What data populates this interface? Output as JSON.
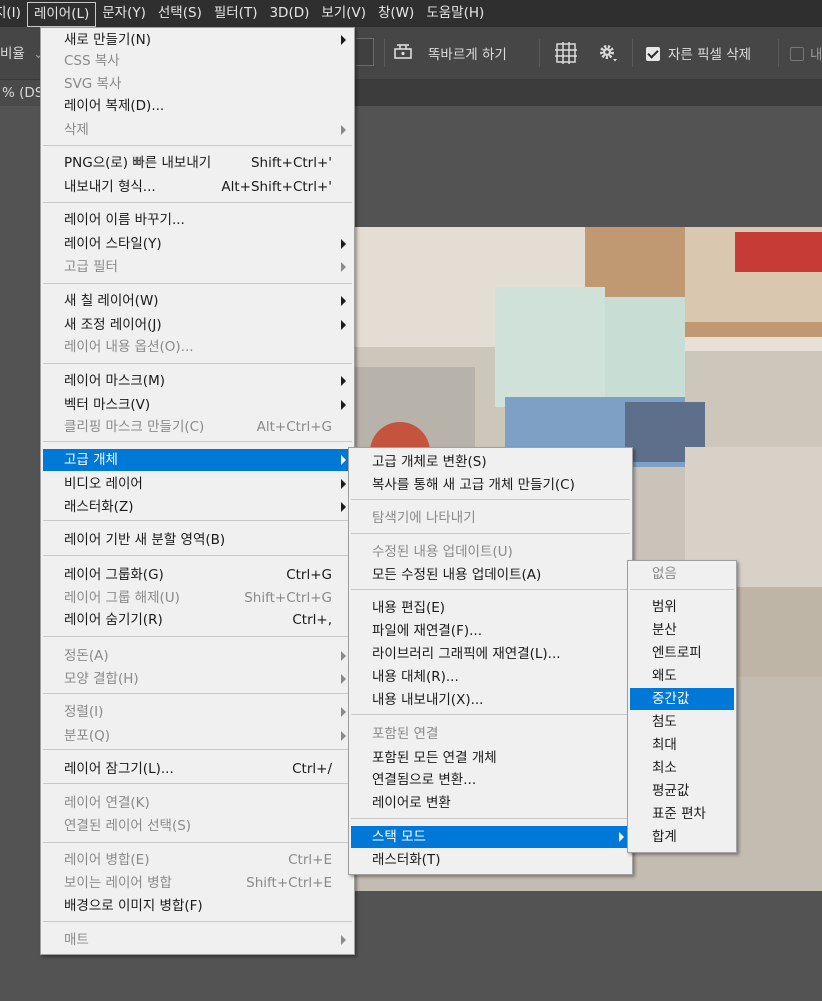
{
  "menubar": {
    "items": [
      "지(I)",
      "레이어(L)",
      "문자(Y)",
      "선택(S)",
      "필터(T)",
      "3D(D)",
      "보기(V)",
      "창(W)",
      "도움말(H)"
    ]
  },
  "optionsbar": {
    "left_label": "비율",
    "straighten_label": "똑바르게 하기",
    "delete_cropped_label": "자른 픽셀 삭제",
    "right_cut_label": "내"
  },
  "tabbar": {
    "tab_label": "% (DS"
  },
  "layer_menu": {
    "items": [
      {
        "label": "새로 만들기(N)",
        "shortcut": "",
        "submenu": true,
        "disabled": false
      },
      {
        "label": "CSS 복사",
        "shortcut": "",
        "submenu": false,
        "disabled": true
      },
      {
        "label": "SVG 복사",
        "shortcut": "",
        "submenu": false,
        "disabled": true
      },
      {
        "label": "레이어 복제(D)...",
        "shortcut": "",
        "submenu": false,
        "disabled": false
      },
      {
        "label": "삭제",
        "shortcut": "",
        "submenu": true,
        "disabled": true
      },
      {
        "label": "PNG으(로) 빠른 내보내기",
        "shortcut": "Shift+Ctrl+'",
        "submenu": false,
        "disabled": false
      },
      {
        "label": "내보내기 형식...",
        "shortcut": "Alt+Shift+Ctrl+'",
        "submenu": false,
        "disabled": false
      },
      {
        "label": "레이어 이름 바꾸기...",
        "shortcut": "",
        "submenu": false,
        "disabled": false
      },
      {
        "label": "레이어 스타일(Y)",
        "shortcut": "",
        "submenu": true,
        "disabled": false
      },
      {
        "label": "고급 필터",
        "shortcut": "",
        "submenu": true,
        "disabled": true
      },
      {
        "label": "새 칠 레이어(W)",
        "shortcut": "",
        "submenu": true,
        "disabled": false
      },
      {
        "label": "새 조정 레이어(J)",
        "shortcut": "",
        "submenu": true,
        "disabled": false
      },
      {
        "label": "레이어 내용 옵션(O)...",
        "shortcut": "",
        "submenu": false,
        "disabled": true
      },
      {
        "label": "레이어 마스크(M)",
        "shortcut": "",
        "submenu": true,
        "disabled": false
      },
      {
        "label": "벡터 마스크(V)",
        "shortcut": "",
        "submenu": true,
        "disabled": false
      },
      {
        "label": "클리핑 마스크 만들기(C)",
        "shortcut": "Alt+Ctrl+G",
        "submenu": false,
        "disabled": true
      },
      {
        "label": "고급 개체",
        "shortcut": "",
        "submenu": true,
        "disabled": false,
        "highlighted": true
      },
      {
        "label": "비디오 레이어",
        "shortcut": "",
        "submenu": true,
        "disabled": false
      },
      {
        "label": "래스터화(Z)",
        "shortcut": "",
        "submenu": true,
        "disabled": false
      },
      {
        "label": "레이어 기반 새 분할 영역(B)",
        "shortcut": "",
        "submenu": false,
        "disabled": false
      },
      {
        "label": "레이어 그룹화(G)",
        "shortcut": "Ctrl+G",
        "submenu": false,
        "disabled": false
      },
      {
        "label": "레이어 그룹 해제(U)",
        "shortcut": "Shift+Ctrl+G",
        "submenu": false,
        "disabled": true
      },
      {
        "label": "레이어 숨기기(R)",
        "shortcut": "Ctrl+,",
        "submenu": false,
        "disabled": false
      },
      {
        "label": "정돈(A)",
        "shortcut": "",
        "submenu": true,
        "disabled": true
      },
      {
        "label": "모양 결합(H)",
        "shortcut": "",
        "submenu": true,
        "disabled": true
      },
      {
        "label": "정렬(I)",
        "shortcut": "",
        "submenu": true,
        "disabled": true
      },
      {
        "label": "분포(Q)",
        "shortcut": "",
        "submenu": true,
        "disabled": true
      },
      {
        "label": "레이어 잠그기(L)...",
        "shortcut": "Ctrl+/",
        "submenu": false,
        "disabled": false
      },
      {
        "label": "레이어 연결(K)",
        "shortcut": "",
        "submenu": false,
        "disabled": true
      },
      {
        "label": "연결된 레이어 선택(S)",
        "shortcut": "",
        "submenu": false,
        "disabled": true
      },
      {
        "label": "레이어 병합(E)",
        "shortcut": "Ctrl+E",
        "submenu": false,
        "disabled": true
      },
      {
        "label": "보이는 레이어 병합",
        "shortcut": "Shift+Ctrl+E",
        "submenu": false,
        "disabled": true
      },
      {
        "label": "배경으로 이미지 병합(F)",
        "shortcut": "",
        "submenu": false,
        "disabled": false
      },
      {
        "label": "매트",
        "shortcut": "",
        "submenu": true,
        "disabled": true
      }
    ]
  },
  "smart_object_menu": {
    "items": [
      {
        "label": "고급 개체로 변환(S)",
        "submenu": false,
        "disabled": false
      },
      {
        "label": "복사를 통해 새 고급 개체 만들기(C)",
        "submenu": false,
        "disabled": false
      },
      {
        "label": "탐색기에 나타내기",
        "submenu": false,
        "disabled": true
      },
      {
        "label": "수정된 내용 업데이트(U)",
        "submenu": false,
        "disabled": true
      },
      {
        "label": "모든 수정된 내용 업데이트(A)",
        "submenu": false,
        "disabled": false
      },
      {
        "label": "내용 편집(E)",
        "submenu": false,
        "disabled": false
      },
      {
        "label": "파일에 재연결(F)...",
        "submenu": false,
        "disabled": false
      },
      {
        "label": "라이브러리 그래픽에 재연결(L)...",
        "submenu": false,
        "disabled": false
      },
      {
        "label": "내용 대체(R)...",
        "submenu": false,
        "disabled": false
      },
      {
        "label": "내용 내보내기(X)...",
        "submenu": false,
        "disabled": false
      },
      {
        "label": "포함된 연결",
        "submenu": false,
        "disabled": true
      },
      {
        "label": "포함된 모든 연결 개체",
        "submenu": false,
        "disabled": false
      },
      {
        "label": "연결됨으로 변환...",
        "submenu": false,
        "disabled": false
      },
      {
        "label": "레이어로 변환",
        "submenu": false,
        "disabled": false
      },
      {
        "label": "스택 모드",
        "submenu": true,
        "disabled": false,
        "highlighted": true
      },
      {
        "label": "래스터화(T)",
        "submenu": false,
        "disabled": false
      }
    ]
  },
  "stack_mode_menu": {
    "items": [
      {
        "label": "없음",
        "disabled": true
      },
      {
        "label": "범위",
        "disabled": false
      },
      {
        "label": "분산",
        "disabled": false
      },
      {
        "label": "엔트로피",
        "disabled": false
      },
      {
        "label": "왜도",
        "disabled": false
      },
      {
        "label": "중간값",
        "disabled": false,
        "highlighted": true
      },
      {
        "label": "첨도",
        "disabled": false
      },
      {
        "label": "최대",
        "disabled": false
      },
      {
        "label": "최소",
        "disabled": false
      },
      {
        "label": "평균값",
        "disabled": false
      },
      {
        "label": "표준 편차",
        "disabled": false
      },
      {
        "label": "합계",
        "disabled": false
      }
    ]
  },
  "colors": {
    "highlight": "#0078d7",
    "menu_bg": "#f0f0f0",
    "app_bg": "#535353"
  }
}
